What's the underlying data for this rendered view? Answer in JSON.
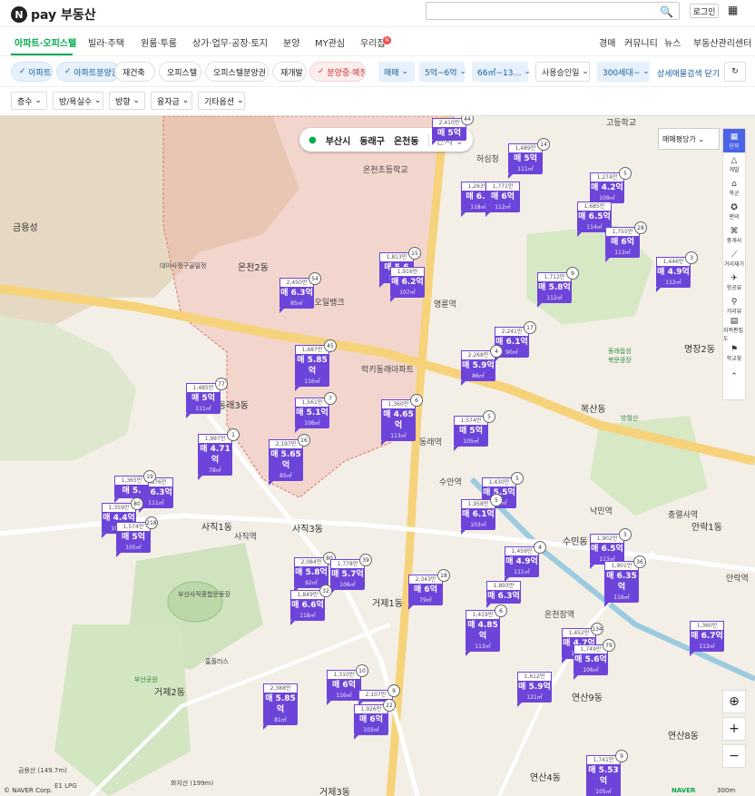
{
  "header": {
    "brand": "pay 부동산",
    "brand_mark": "N",
    "login": "로그인",
    "search_placeholder": ""
  },
  "nav": {
    "items": [
      "아파트·오피스텔",
      "빌라·주택",
      "원룸·투룸",
      "상가·업무·공장·토지",
      "분양",
      "MY관심",
      "우리집"
    ],
    "right": [
      "경매",
      "커뮤니티",
      "뉴스",
      "부동산관리센터"
    ],
    "new_badge": "N"
  },
  "filters": {
    "chips": [
      "아파트",
      "아파트분양권",
      "재건축",
      "오피스텔",
      "오피스텔분양권",
      "재개발",
      "분양중·예정"
    ],
    "dropdowns": [
      "매매",
      "5억~6억",
      "66㎡~13…",
      "사용승인일",
      "300세대~"
    ],
    "detail_close": "상세매물검색 닫기",
    "second": [
      "층수",
      "방/욕실수",
      "방향",
      "융자금",
      "기타옵션"
    ]
  },
  "map": {
    "breadcrumb": {
      "city": "부산시",
      "district": "동래구",
      "dong": "온천동",
      "tab": "단지"
    },
    "sort_label": "매매평당가",
    "sidebar": [
      {
        "label": "단지",
        "icon": "building-icon"
      },
      {
        "label": "개발",
        "icon": "triangle-icon"
      },
      {
        "label": "학군",
        "icon": "school-icon"
      },
      {
        "label": "편의",
        "icon": "star-icon"
      },
      {
        "label": "중개사",
        "icon": "agent-icon"
      },
      {
        "label": "거리재기",
        "icon": "ruler-icon"
      },
      {
        "label": "항공뷰",
        "icon": "plane-icon"
      },
      {
        "label": "거리뷰",
        "icon": "pin-icon"
      },
      {
        "label": "지적편집도",
        "icon": "map-icon"
      },
      {
        "label": "학교찾",
        "icon": "graduation-icon"
      }
    ],
    "markers": [
      {
        "top_line": "2,410만",
        "price": "매 5억",
        "area": "",
        "count": "44"
      },
      {
        "top_line": "1,489만",
        "price": "매 5억",
        "area": "111㎡",
        "count": "14"
      },
      {
        "top_line": "1,263만",
        "price": "매 6.3",
        "area": "118㎡",
        "count": ""
      },
      {
        "top_line": "1,771만",
        "price": "매 6억",
        "area": "112㎡",
        "count": ""
      },
      {
        "top_line": "1,274만",
        "price": "매 4.2억",
        "area": "109㎡",
        "count": "5"
      },
      {
        "top_line": "1,685만",
        "price": "매 6.5억",
        "area": "114㎡",
        "count": ""
      },
      {
        "top_line": "1,755만",
        "price": "매 6억",
        "area": "113㎡",
        "count": "28"
      },
      {
        "top_line": "1,446만",
        "price": "매 4.9억",
        "area": "112㎡",
        "count": "3"
      },
      {
        "top_line": "2,450만",
        "price": "매 6.3억",
        "area": "85㎡",
        "count": "54"
      },
      {
        "top_line": "1,813만",
        "price": "매 5.6",
        "area": "108㎡",
        "count": "15"
      },
      {
        "top_line": "1,916만",
        "price": "매 6.2억",
        "area": "107㎡",
        "count": ""
      },
      {
        "top_line": "1,712만",
        "price": "매 5.8억",
        "area": "112㎡",
        "count": "9"
      },
      {
        "top_line": "2,241만",
        "price": "매 6.1억",
        "area": "90㎡",
        "count": "17"
      },
      {
        "top_line": "1,687만",
        "price": "매 5.85억",
        "area": "116㎡",
        "count": "45"
      },
      {
        "top_line": "2,268만",
        "price": "매 5.9억",
        "area": "86㎡",
        "count": "4"
      },
      {
        "top_line": "1,485만",
        "price": "매 5억",
        "area": "111㎡",
        "count": "77"
      },
      {
        "top_line": "1,561만",
        "price": "매 5.1억",
        "area": "108㎡",
        "count": "7"
      },
      {
        "top_line": "1,360만",
        "price": "매 4.65억",
        "area": "113㎡",
        "count": "6"
      },
      {
        "top_line": "1,574만",
        "price": "매 5억",
        "area": "105㎡",
        "count": "5"
      },
      {
        "top_line": "1,997만",
        "price": "매 4.71억",
        "area": "78㎡",
        "count": "1"
      },
      {
        "top_line": "2,197만",
        "price": "매 5.65억",
        "area": "85㎡",
        "count": "16"
      },
      {
        "top_line": "1,430만",
        "price": "매 5.5억",
        "area": "111㎡",
        "count": "5"
      },
      {
        "top_line": "1,876만",
        "price": "매 6.3억",
        "area": "111㎡",
        "count": ""
      },
      {
        "top_line": "1,365만",
        "price": "매 5.",
        "area": "",
        "count": "19"
      },
      {
        "top_line": "1,359만",
        "price": "매 4.4억",
        "area": "107㎡",
        "count": "80"
      },
      {
        "top_line": "1,574만",
        "price": "매 5억",
        "area": "105㎡",
        "count": "218"
      },
      {
        "top_line": "1,958만",
        "price": "매 6.1억",
        "area": "103㎡",
        "count": "5"
      },
      {
        "top_line": "1,902만",
        "price": "매 6.5억",
        "area": "113㎡",
        "count": "5"
      },
      {
        "top_line": "1,901만",
        "price": "매 6.35억",
        "area": "116㎡",
        "count": "36"
      },
      {
        "top_line": "2,084만",
        "price": "매 5.8억",
        "area": "92㎡",
        "count": "80"
      },
      {
        "top_line": "1,778만",
        "price": "매 5.7억",
        "area": "106㎡",
        "count": "39"
      },
      {
        "top_line": "1,849만",
        "price": "매 6.6억",
        "area": "118㎡",
        "count": "32"
      },
      {
        "top_line": "2,343만",
        "price": "매 6억",
        "area": "79㎡",
        "count": "18"
      },
      {
        "top_line": "1,459만",
        "price": "매 4.9억",
        "area": "111㎡",
        "count": "4"
      },
      {
        "top_line": "1,893만",
        "price": "매 6.3억",
        "area": "",
        "count": ""
      },
      {
        "top_line": "1,419만",
        "price": "매 4.85억",
        "area": "113㎡",
        "count": "6"
      },
      {
        "top_line": "1,360만",
        "price": "매 6.7억",
        "area": "113㎡",
        "count": ""
      },
      {
        "top_line": "1,452만",
        "price": "매 4.7억",
        "area": "106㎡",
        "count": "134"
      },
      {
        "top_line": "1,749만",
        "price": "매 5.6억",
        "area": "106㎡",
        "count": "79"
      },
      {
        "top_line": "1,612만",
        "price": "매 5.9억",
        "area": "121㎡",
        "count": ""
      },
      {
        "top_line": "2,388만",
        "price": "매 5.85억",
        "area": "81㎡",
        "count": ""
      },
      {
        "top_line": "1,310만",
        "price": "매 6억",
        "area": "116㎡",
        "count": "10"
      },
      {
        "top_line": "2,107만",
        "price": "",
        "area": "",
        "count": "9"
      },
      {
        "top_line": "1,926만",
        "price": "매 6억",
        "area": "103㎡",
        "count": "22"
      },
      {
        "top_line": "1,741만",
        "price": "매 5.53억",
        "area": "105㎡",
        "count": "9"
      }
    ],
    "labels": [
      "금용성",
      "대아사정구골밀정",
      "허심청",
      "고등학교",
      "온천초등학교",
      "온천2동",
      "현대오일뱅크",
      "럭키동래아파트",
      "동래3동",
      "사직3동",
      "사직역",
      "동래역",
      "명장2동",
      "수안역",
      "명륜역",
      "충렬사역",
      "안락1동",
      "온천장역",
      "연산8동",
      "연산4동",
      "연산9동",
      "거제3동",
      "거제2동",
      "거제1동",
      "사직1동",
      "부산사직종합운동장",
      "홈플러스",
      "화지산 (199m)",
      "금용산 (149.7m)",
      "E1 LPG",
      "부산공원",
      "북문광장",
      "동래읍성",
      "방월산",
      "안락역",
      "낙민역",
      "복산동",
      "수민동"
    ],
    "copyright": "© NAVER Corp.",
    "naver": "NAVER",
    "scale": "300m"
  }
}
